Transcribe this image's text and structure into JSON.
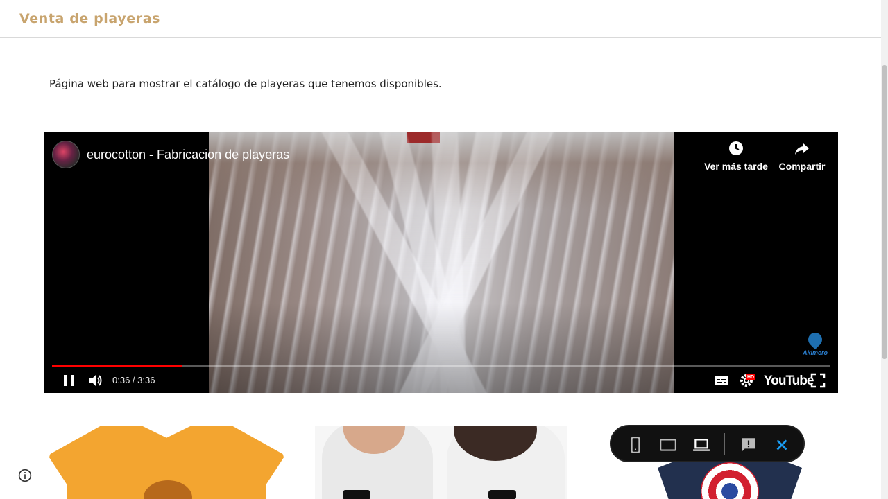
{
  "site": {
    "title": "Venta de playeras"
  },
  "intro": {
    "text": "Página web para mostrar el catálogo de playeras que tenemos disponibles."
  },
  "video": {
    "channel_title": "eurocotton - Fabricacion de playeras",
    "watch_later_label": "Ver más tarde",
    "share_label": "Compartir",
    "time_display": "0:36 / 3:36",
    "progress_fraction": 0.167,
    "hd_badge": "HD",
    "logo_text": "YouTube",
    "watermark_text": "Akimero",
    "progress_color": "#ff0000"
  },
  "products": [
    {
      "name": "orange-tshirt"
    },
    {
      "name": "couple-white-tshirts"
    },
    {
      "name": "captain-america-tshirt"
    }
  ],
  "device_toolbar": {
    "icons": [
      "phone-icon",
      "tablet-icon",
      "laptop-icon",
      "feedback-icon",
      "close-icon"
    ],
    "active": "laptop-icon",
    "close_color": "#1a9bf0"
  },
  "colors": {
    "title": "#c8a46e"
  }
}
